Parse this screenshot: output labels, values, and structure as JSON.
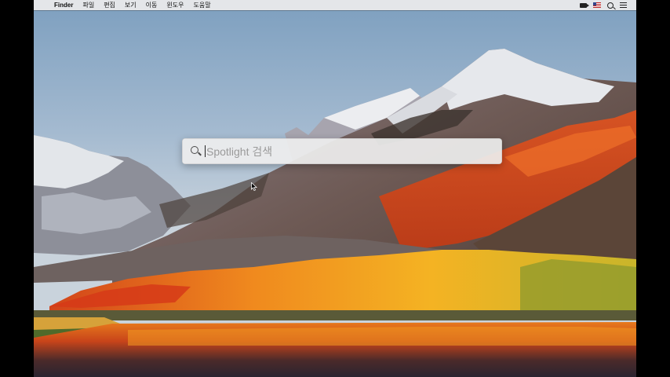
{
  "menubar": {
    "apple_glyph": "",
    "items": [
      "Finder",
      "파일",
      "편집",
      "보기",
      "이동",
      "윈도우",
      "도움말"
    ],
    "status_icons": [
      "video-camera-icon",
      "us-flag-input-icon",
      "spotlight-search-icon",
      "notification-list-icon"
    ]
  },
  "spotlight": {
    "placeholder": "Spotlight 검색",
    "value": "",
    "icon": "magnifier-icon"
  },
  "desktop": {
    "wallpaper": "high-sierra-mountain-lake"
  },
  "colors": {
    "menubar_bg": "#ececec",
    "spotlight_bg": "#eeeeee",
    "autumn_orange": "#e8611a",
    "sky": "#a6bdd2"
  }
}
